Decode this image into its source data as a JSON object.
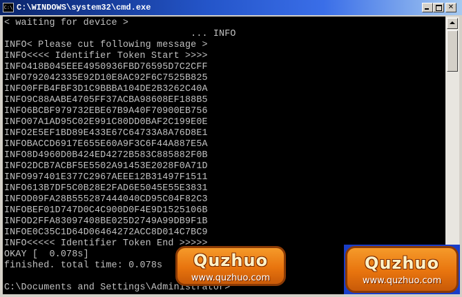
{
  "window": {
    "title": "C:\\WINDOWS\\system32\\cmd.exe",
    "icon_label": "C:\\"
  },
  "console": {
    "lines": [
      "< waiting for device >",
      "                                 ... INFO",
      "INFO< Please cut following message >",
      "INFO<<<< Identifier Token Start >>>>",
      "INFO418B045EEE4950936FBD76595D7C2CFF",
      "INFO792042335E92D10E8AC92F6C7525B825",
      "INFO0FFB4FBF3D1C9BBBA104DE2B3262C40A",
      "INFO9C88AABE4705FF37ACBA98608EF188B5",
      "INFO6BCBF979732EBE67B9A40F70900EB756",
      "INFO07A1AD95C02E991C80DD0BAF2C199E0E",
      "INFO2E5EF1BD89E433E67C64733A8A76D8E1",
      "INFOBACCD6917E655E60A9F3C6F44A887E5A",
      "INFO8D4960D0B424ED4272B583C885882F0B",
      "INFO2DCB7ACBF5E5502A91453E2028F0A71D",
      "INFO997401E377C2967AEEE12B31497F1511",
      "INFO613B7DF5C0B28E2FAD6E5045E55E3831",
      "INFOD09FA28B555287444040CD95C04F82C3",
      "INFOBEF01D747D0C4C900D0F4E9D1525106B",
      "INFOD2FFA83097408BE025D2749A99DB9F1B",
      "INFOE0C35C1D64D06464272ACC8D014C7BC9",
      "INFO<<<<< Identifier Token End >>>>>",
      "OKAY [  0.078s]",
      "finished. total time: 0.078s",
      "",
      "C:\\Documents and Settings\\Administrator>"
    ]
  },
  "watermarks": [
    {
      "title": "Quzhuo",
      "url": "www.quzhuo.com"
    },
    {
      "title": "Quzhuo",
      "url": "www.quzhuo.com"
    }
  ],
  "colors": {
    "titlebar_start": "#0a246a",
    "titlebar_end": "#a6caf0",
    "console_bg": "#000000",
    "console_fg": "#c0c0c0",
    "watermark_orange": "#e8740e",
    "watermark_blue_bg": "#1a3ec8"
  },
  "icons": {
    "title_icon": "cmd-icon",
    "minimize": "minimize-icon",
    "maximize": "maximize-icon",
    "close": "close-icon",
    "scroll_up": "scroll-up-arrow-icon",
    "scroll_down": "scroll-down-arrow-icon"
  }
}
